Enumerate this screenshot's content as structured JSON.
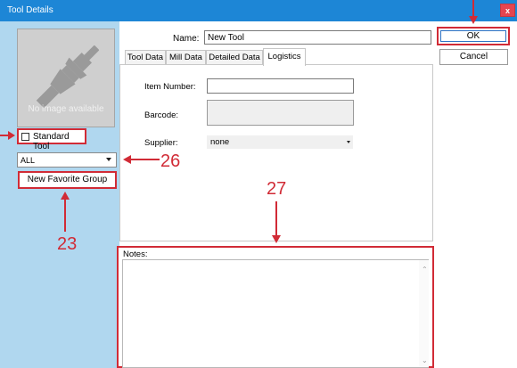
{
  "window": {
    "title": "Tool Details",
    "close_label": "x"
  },
  "left_panel": {
    "image_placeholder": "No image available",
    "standard_tool_label": "Standard Tool",
    "standard_tool_checked": false,
    "group_select_value": "ALL",
    "favorite_button_label": "New Favorite Group"
  },
  "name_field": {
    "label": "Name:",
    "value": "New Tool"
  },
  "tabs": [
    {
      "label": "Tool Data",
      "active": false
    },
    {
      "label": "Mill Data",
      "active": false
    },
    {
      "label": "Detailed Data",
      "active": false
    },
    {
      "label": "Logistics",
      "active": true
    }
  ],
  "logistics": {
    "item_number_label": "Item Number:",
    "item_number_value": "",
    "barcode_label": "Barcode:",
    "barcode_value": "",
    "supplier_label": "Supplier:",
    "supplier_value": "none"
  },
  "buttons": {
    "ok_label": "OK",
    "cancel_label": "Cancel"
  },
  "notes": {
    "label": "Notes:",
    "value": ""
  },
  "callouts": {
    "favorite": "23",
    "group_select": "26",
    "notes": "27"
  },
  "colors": {
    "titlebar": "#1d86d6",
    "left_panel": "#b0d7ef",
    "callout_red": "#d12b36",
    "close_button": "#e64550"
  },
  "icons": {
    "tool_image": "tool-holder-icon",
    "close": "close-icon",
    "dropdown": "chevron-down-icon"
  }
}
